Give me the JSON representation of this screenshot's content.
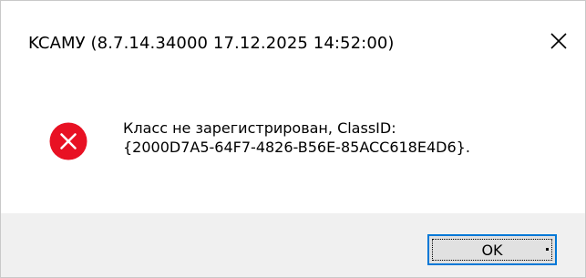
{
  "dialog": {
    "title": "KCAMУ (8.7.14.34000 17.12.2025 14:52:00)",
    "icon": "error-icon",
    "message_line1": "Класс не зарегистрирован, ClassID:",
    "message_line2": "{2000D7A5-64F7-4826-B56E-85ACC618E4D6}.",
    "ok_label": "OK",
    "close_icon": "close-icon"
  },
  "colors": {
    "error_red": "#e81123",
    "button_border_focus": "#0078d7",
    "footer_bg": "#f0f0f0"
  }
}
